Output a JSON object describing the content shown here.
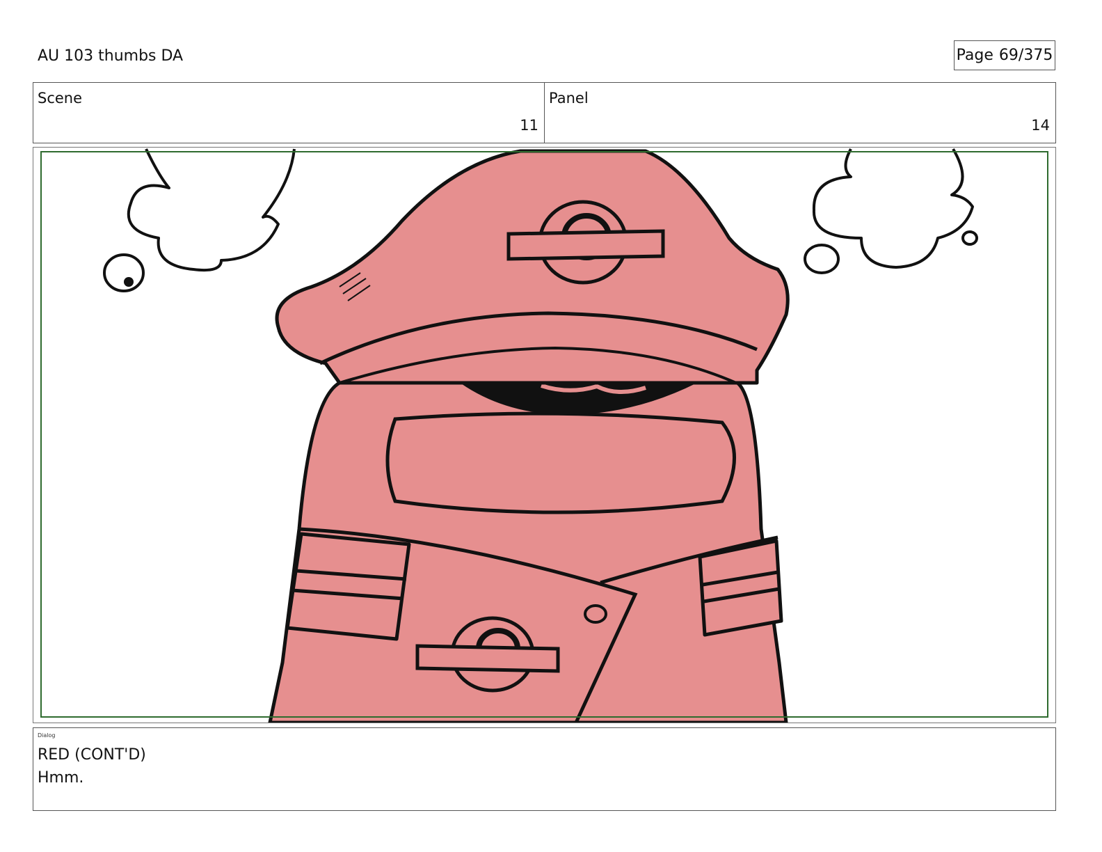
{
  "header": {
    "title": "AU 103 thumbs DA",
    "page_label": "Page",
    "page_value": "69/375"
  },
  "info": {
    "scene_label": "Scene",
    "scene_value": "11",
    "panel_label": "Panel",
    "panel_value": "14"
  },
  "dialog": {
    "label": "Dialog",
    "speaker": "RED (CONT'D)",
    "line": "Hmm."
  },
  "colors": {
    "safe_frame": "#2e6b2e",
    "character_fill": "#e68f8f"
  }
}
